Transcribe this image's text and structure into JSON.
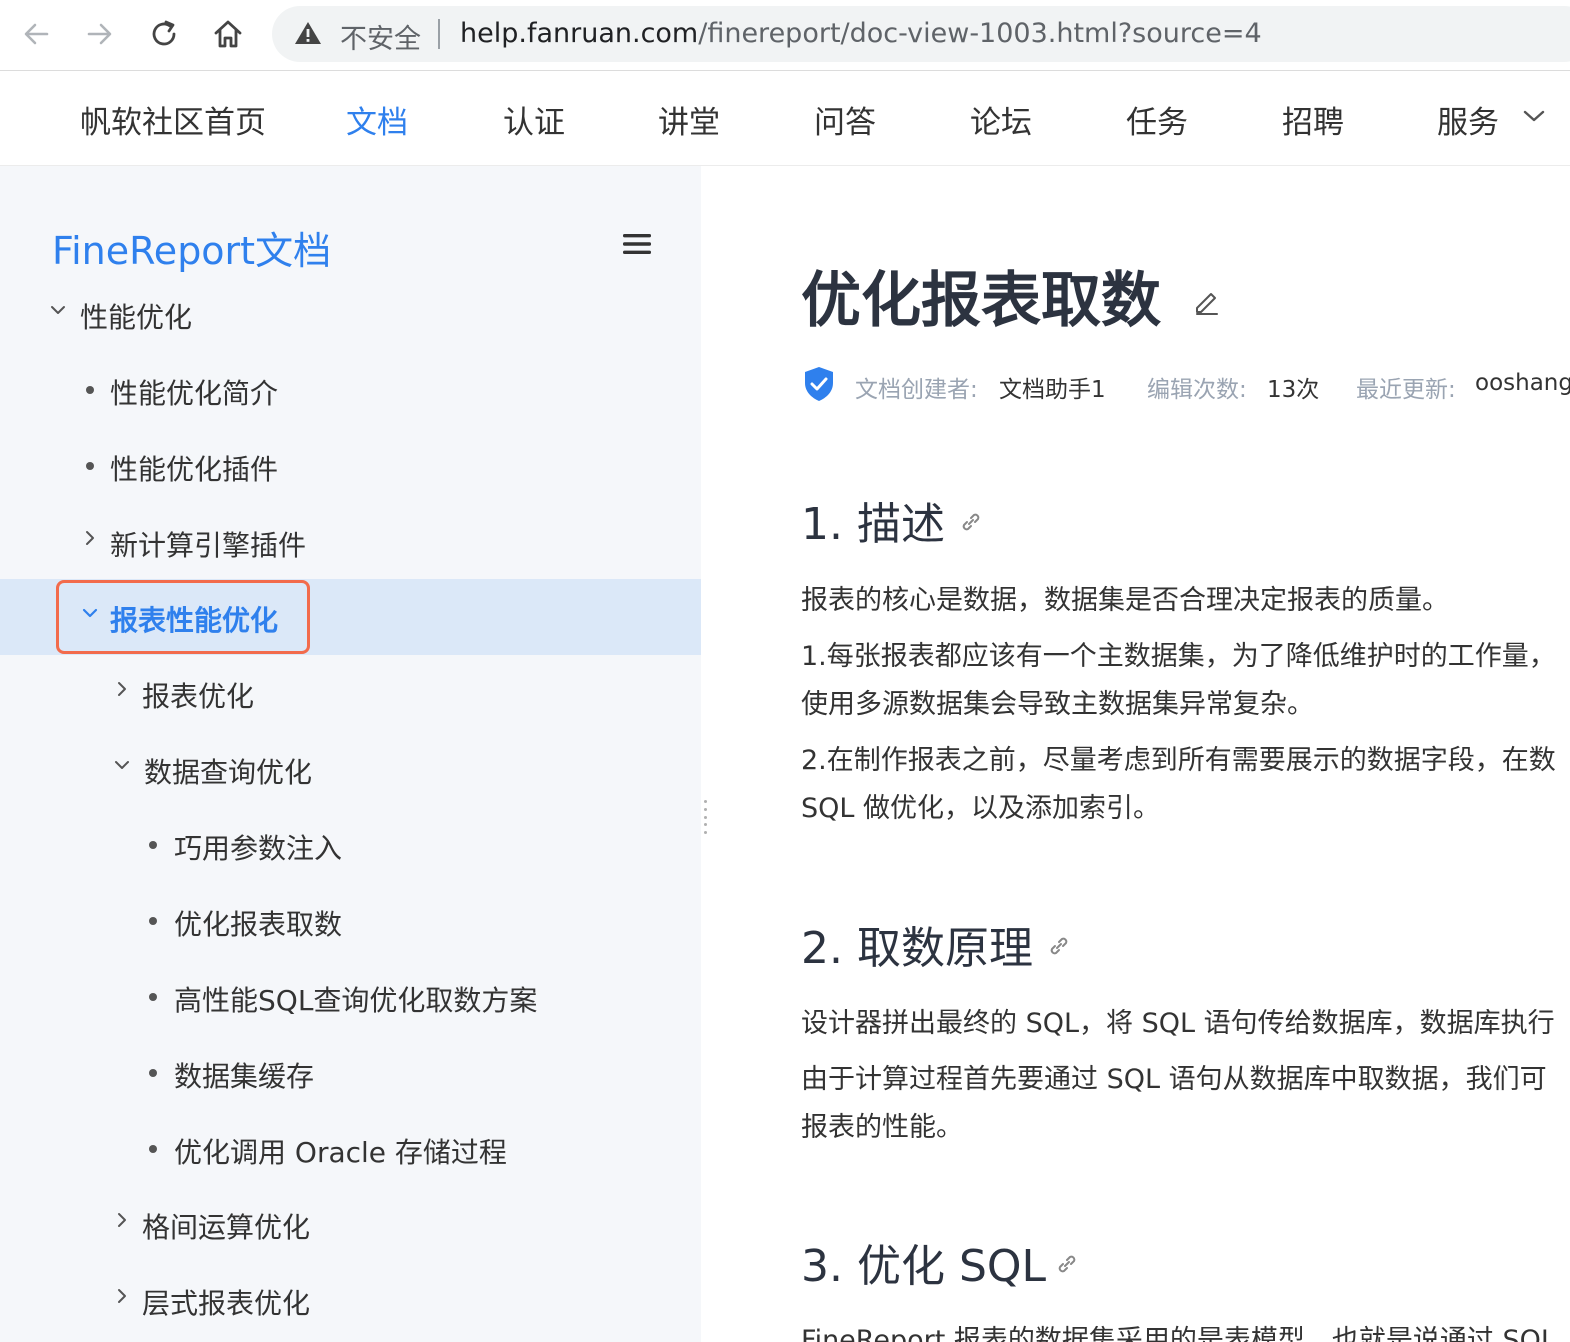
{
  "browser": {
    "insecure_label": "不安全",
    "url_host": "help.fanruan.com",
    "url_path": "/finereport/doc-view-1003.html?source=4"
  },
  "site_nav": {
    "items": [
      {
        "label": "帆软社区首页"
      },
      {
        "label": "文档",
        "active": true
      },
      {
        "label": "认证"
      },
      {
        "label": "讲堂"
      },
      {
        "label": "问答"
      },
      {
        "label": "论坛"
      },
      {
        "label": "任务"
      },
      {
        "label": "招聘"
      },
      {
        "label": "服务"
      }
    ]
  },
  "sidebar": {
    "title": "FineReport文档",
    "items": [
      {
        "label": "性能优化",
        "marker": "caret-down"
      },
      {
        "label": "性能优化简介",
        "marker": "dot"
      },
      {
        "label": "性能优化插件",
        "marker": "dot"
      },
      {
        "label": "新计算引擎插件",
        "marker": "caret-right"
      },
      {
        "label": "报表性能优化",
        "marker": "caret-down",
        "selected": true
      },
      {
        "label": "报表优化",
        "marker": "caret-right"
      },
      {
        "label": "数据查询优化",
        "marker": "caret-down"
      },
      {
        "label": "巧用参数注入",
        "marker": "dot"
      },
      {
        "label": "优化报表取数",
        "marker": "dot"
      },
      {
        "label": "高性能SQL查询优化取数方案",
        "marker": "dot"
      },
      {
        "label": "数据集缓存",
        "marker": "dot"
      },
      {
        "label": "优化调用 Oracle 存储过程",
        "marker": "dot"
      },
      {
        "label": "格间运算优化",
        "marker": "caret-right"
      },
      {
        "label": "层式报表优化",
        "marker": "caret-right"
      }
    ]
  },
  "content": {
    "title": "优化报表取数",
    "meta": {
      "creator_key": "文档创建者:",
      "creator_val": "文档助手1",
      "edits_key": "编辑次数:",
      "edits_val": "13次",
      "updated_key": "最近更新:",
      "updated_val": "ooshang"
    },
    "sections": [
      {
        "heading": "1. 描述",
        "paragraphs": [
          "报表的核心是数据，数据集是否合理决定报表的质量。",
          "1.每张报表都应该有一个主数据集，为了降低维护时的工作量，",
          "使用多源数据集会导致主数据集异常复杂。",
          "2.在制作报表之前，尽量考虑到所有需要展示的数据字段，在数",
          "SQL 做优化，以及添加索引。"
        ]
      },
      {
        "heading": "2. 取数原理",
        "paragraphs": [
          "设计器拼出最终的 SQL，将 SQL 语句传给数据库，数据库执行",
          "由于计算过程首先要通过 SQL 语句从数据库中取数据，我们可",
          "报表的性能。"
        ]
      },
      {
        "heading": "3. 优化 SQL",
        "paragraphs": [
          "FineReport 报表的数据集采用的是表模型，也就是说通过 SQL"
        ]
      }
    ]
  },
  "colors": {
    "accent": "#2f80ed",
    "highlight_border": "#f26b4c",
    "selected_bg": "#dbe8f8",
    "sidebar_bg": "#f5f7fa",
    "shield": "#2f80ed"
  }
}
